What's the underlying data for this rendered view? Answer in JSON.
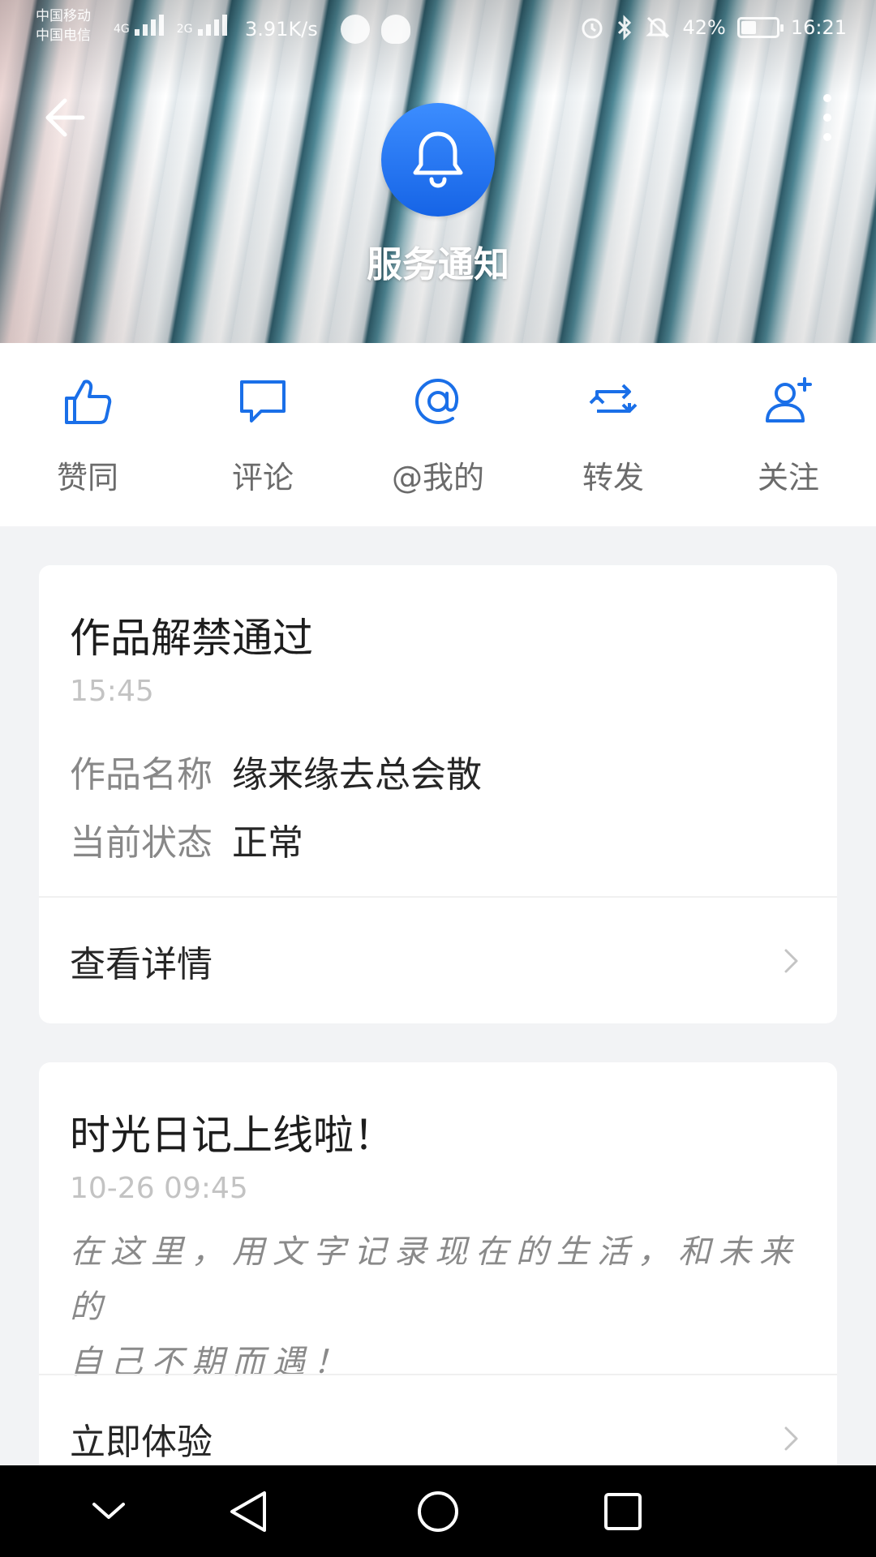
{
  "status_bar": {
    "carrier_1": "中国移动",
    "carrier_2": "中国电信",
    "net_type_1": "4G",
    "net_type_2": "2G",
    "net_speed": "3.91K/s",
    "battery": "42%",
    "battery_level": 0.42,
    "time": "16:21"
  },
  "header": {
    "title": "服务通知",
    "avatar_icon": "bell-icon",
    "accent": "#1a6fe8"
  },
  "shortcuts": [
    {
      "label": "赞同",
      "icon": "thumbs-up-icon"
    },
    {
      "label": "评论",
      "icon": "comment-icon"
    },
    {
      "label": "@我的",
      "icon": "at-icon"
    },
    {
      "label": "转发",
      "icon": "repost-icon"
    },
    {
      "label": "关注",
      "icon": "add-user-icon"
    }
  ],
  "notifications": [
    {
      "title": "作品解禁通过",
      "time": "15:45",
      "fields": [
        {
          "key": "作品名称",
          "value": "缘来缘去总会散"
        },
        {
          "key": "当前状态",
          "value": "正常"
        }
      ],
      "action": "查看详情"
    },
    {
      "title": "时光日记上线啦！",
      "time": "10-26 09:45",
      "desc_line_1": "在这里，用文字记录现在的生活，和未来的",
      "desc_line_2": "自己不期而遇！",
      "action": "立即体验"
    }
  ]
}
